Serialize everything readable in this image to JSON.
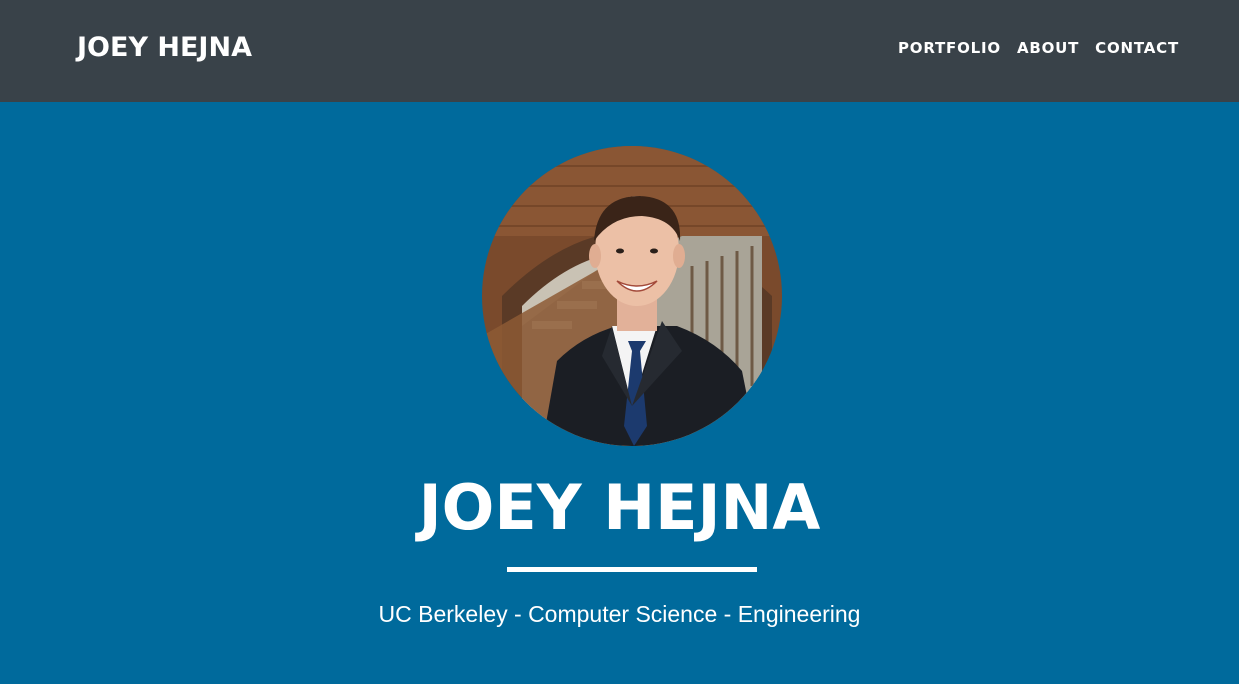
{
  "navbar": {
    "brand": "JOEY HEJNA",
    "links": [
      "PORTFOLIO",
      "ABOUT",
      "CONTACT"
    ]
  },
  "hero": {
    "name": "JOEY HEJNA",
    "tagline": "UC Berkeley - Computer Science - Engineering"
  },
  "colors": {
    "navbar_bg": "#394249",
    "hero_bg": "#006a9c",
    "text": "#ffffff"
  }
}
